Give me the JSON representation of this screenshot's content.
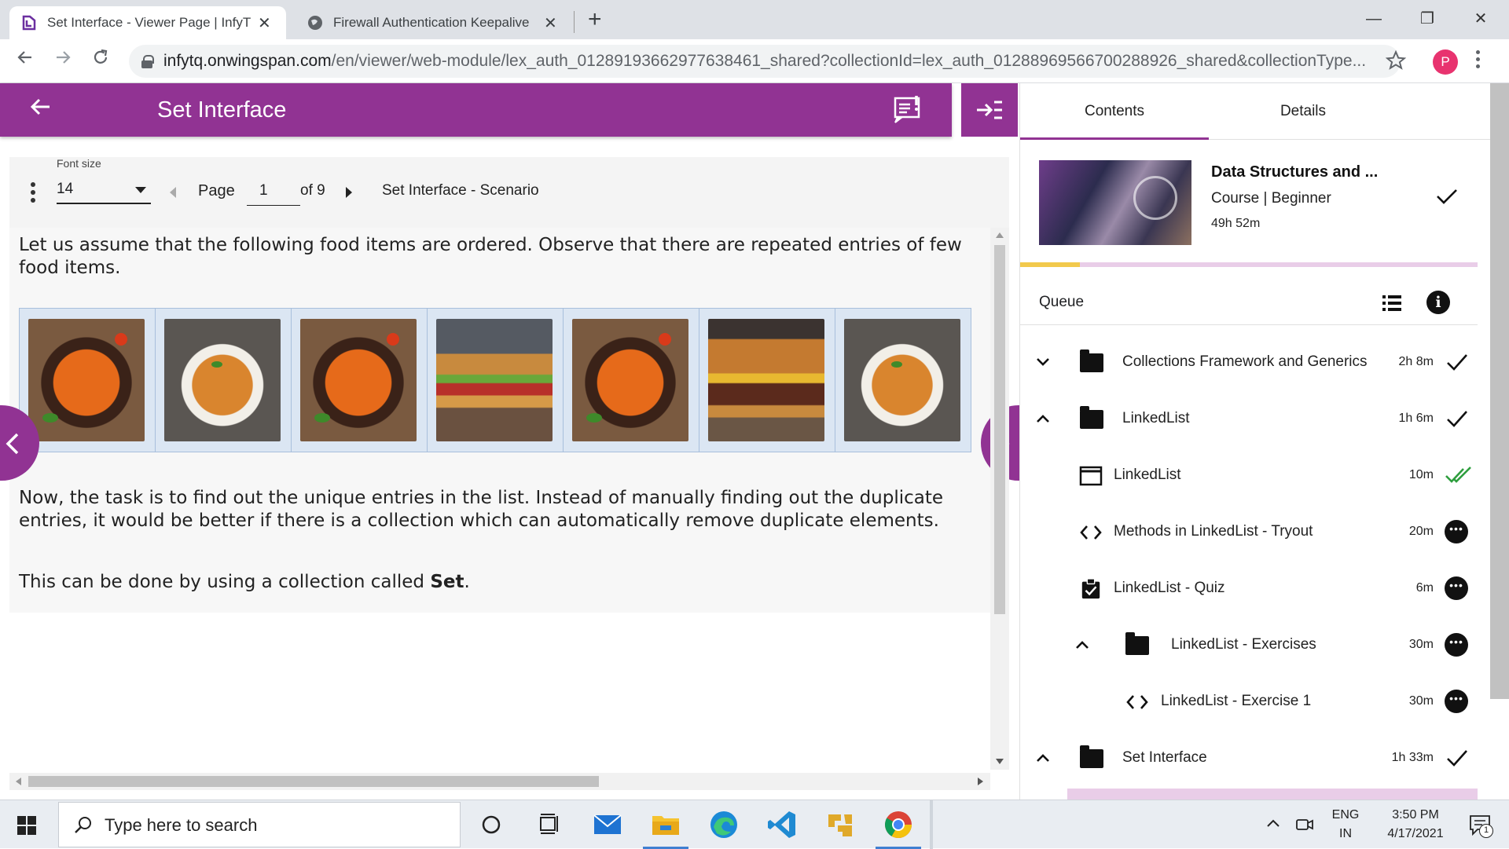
{
  "browser": {
    "tabs": [
      {
        "title": "Set Interface - Viewer Page | InfyTQ",
        "close": "✕"
      },
      {
        "title": "Firewall Authentication Keepalive",
        "close": "✕"
      }
    ],
    "new_tab": "+",
    "window": {
      "minimize": "—",
      "maximize": "❐",
      "close": "✕"
    },
    "url_host": "infytq.onwingspan.com",
    "url_path": "/en/viewer/web-module/lex_auth_01289193662977638461_shared?collectionId=lex_auth_01288969566700288926_shared&collectionType...",
    "profile_initial": "P"
  },
  "header": {
    "title": "Set Interface"
  },
  "viewer": {
    "font_size_label": "Font size",
    "font_size_value": "14",
    "page_label": "Page",
    "page_current": "1",
    "page_of": "of 9",
    "section_title": "Set Interface - Scenario",
    "para1": "Let us assume that the following food items are ordered. Observe that there are repeated entries of few food items.",
    "para2": "Now, the task is to find out the unique entries in the list. Instead of manually finding out the duplicate entries, it would be better if there is a collection which can automatically remove duplicate elements.",
    "para3_prefix": "This can be done by using a collection called ",
    "para3_bold": "Set",
    "para3_suffix": ".",
    "food_items": [
      "pasta",
      "noodles",
      "pasta",
      "sandwich burger",
      "pasta",
      "burger",
      "noodles"
    ]
  },
  "sidebar": {
    "tabs": [
      "Contents",
      "Details"
    ],
    "active_tab": "Contents",
    "course": {
      "title": "Data Structures and ...",
      "type": "Course |  Beginner",
      "duration": "49h 52m",
      "progress_fraction": 0.13
    },
    "queue_label": "Queue",
    "items": [
      {
        "label": "Collections Framework and Generics",
        "time": "2h 8m",
        "kind": "folder",
        "expanded": false,
        "status": "done"
      },
      {
        "label": "LinkedList",
        "time": "1h 6m",
        "kind": "folder",
        "expanded": true,
        "status": "done"
      },
      {
        "label": "LinkedList",
        "time": "10m",
        "kind": "page",
        "status": "completed"
      },
      {
        "label": "Methods in LinkedList - Tryout",
        "time": "20m",
        "kind": "code",
        "status": "more"
      },
      {
        "label": "LinkedList - Quiz",
        "time": "6m",
        "kind": "quiz",
        "status": "more"
      },
      {
        "label": "LinkedList - Exercises",
        "time": "30m",
        "kind": "folder",
        "expanded": true,
        "status": "more"
      },
      {
        "label": "LinkedList - Exercise 1",
        "time": "30m",
        "kind": "code",
        "status": "more"
      },
      {
        "label": "Set Interface",
        "time": "1h 33m",
        "kind": "folder",
        "expanded": true,
        "status": "done"
      }
    ]
  },
  "taskbar": {
    "search_placeholder": "Type here to search",
    "lang_top": "ENG",
    "lang_bottom": "IN",
    "time": "3:50 PM",
    "date": "4/17/2021",
    "notification_count": "1"
  },
  "colors": {
    "brand": "#913393",
    "progress": "#f2c94c",
    "completed_check": "#2e9e3e"
  }
}
